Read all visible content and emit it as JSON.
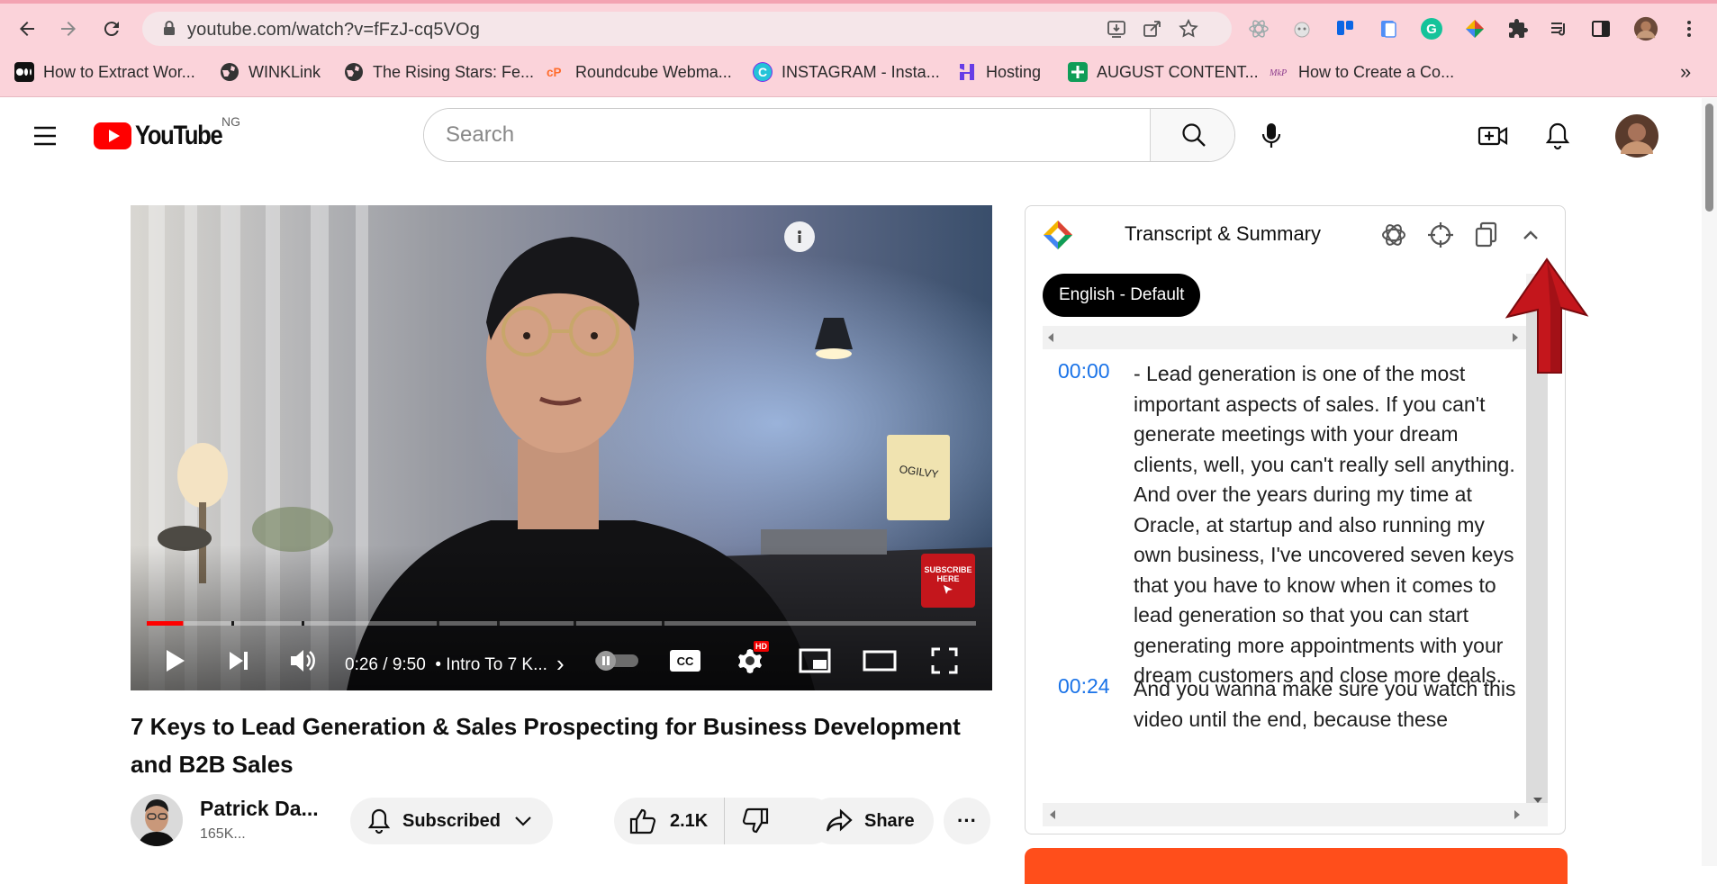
{
  "browser": {
    "url": "youtube.com/watch?v=fFzJ-cq5VOg",
    "bookmarks": [
      {
        "label": "How to Extract Wor...",
        "icon": "medium-icon"
      },
      {
        "label": "WINKLink",
        "icon": "globe-icon"
      },
      {
        "label": "The Rising Stars: Fe...",
        "icon": "globe-icon"
      },
      {
        "label": "Roundcube Webma...",
        "icon": "cpanel-icon"
      },
      {
        "label": "INSTAGRAM - Insta...",
        "icon": "canva-icon"
      },
      {
        "label": "Hosting",
        "icon": "hostinger-icon"
      },
      {
        "label": "AUGUST CONTENT...",
        "icon": "sheets-icon"
      },
      {
        "label": "How to Create a Co...",
        "icon": "site-icon"
      }
    ],
    "more_bookmarks": "»"
  },
  "youtube": {
    "logo_text": "YouTube",
    "country_code": "NG",
    "search_placeholder": "Search"
  },
  "player": {
    "time": "0:26 / 9:50",
    "chapter": "• Intro To 7 K...",
    "chapter_arrow": "›",
    "subscribe_badge_line1": "SUBSCRIBE",
    "subscribe_badge_line2": "HERE",
    "hd_badge": "HD",
    "cc_label": "CC",
    "progress_fraction": 0.044
  },
  "video": {
    "title": "7 Keys to Lead Generation & Sales Prospecting for Business Development and B2B Sales",
    "channel_name": "Patrick Da...",
    "subscribers": "165K...",
    "subscribed_label": "Subscribed",
    "likes": "2.1K",
    "share_label": "Share",
    "more_label": "···"
  },
  "panel": {
    "title": "Transcript & Summary",
    "language_chip": "English - Default",
    "segments": [
      {
        "time": "00:00",
        "text": "- Lead generation is one of the most important aspects of sales. If you can't generate meetings with your dream clients, well, you can't really sell anything. And over the years during my time at Oracle, at startup and also running my own business, I've uncovered seven keys that you have to know when it comes to lead generation so that you can start generating more appointments with your dream customers and close more deals."
      },
      {
        "time": "00:24",
        "text": "And you wanna make sure you watch this video until the end, because these"
      }
    ]
  },
  "colors": {
    "chrome_bg": "#fbd3da",
    "yt_red": "#ff0000",
    "timestamp_blue": "#1a73e8",
    "arrow_red": "#c4161c",
    "orange_bar": "#ff4e1b"
  }
}
